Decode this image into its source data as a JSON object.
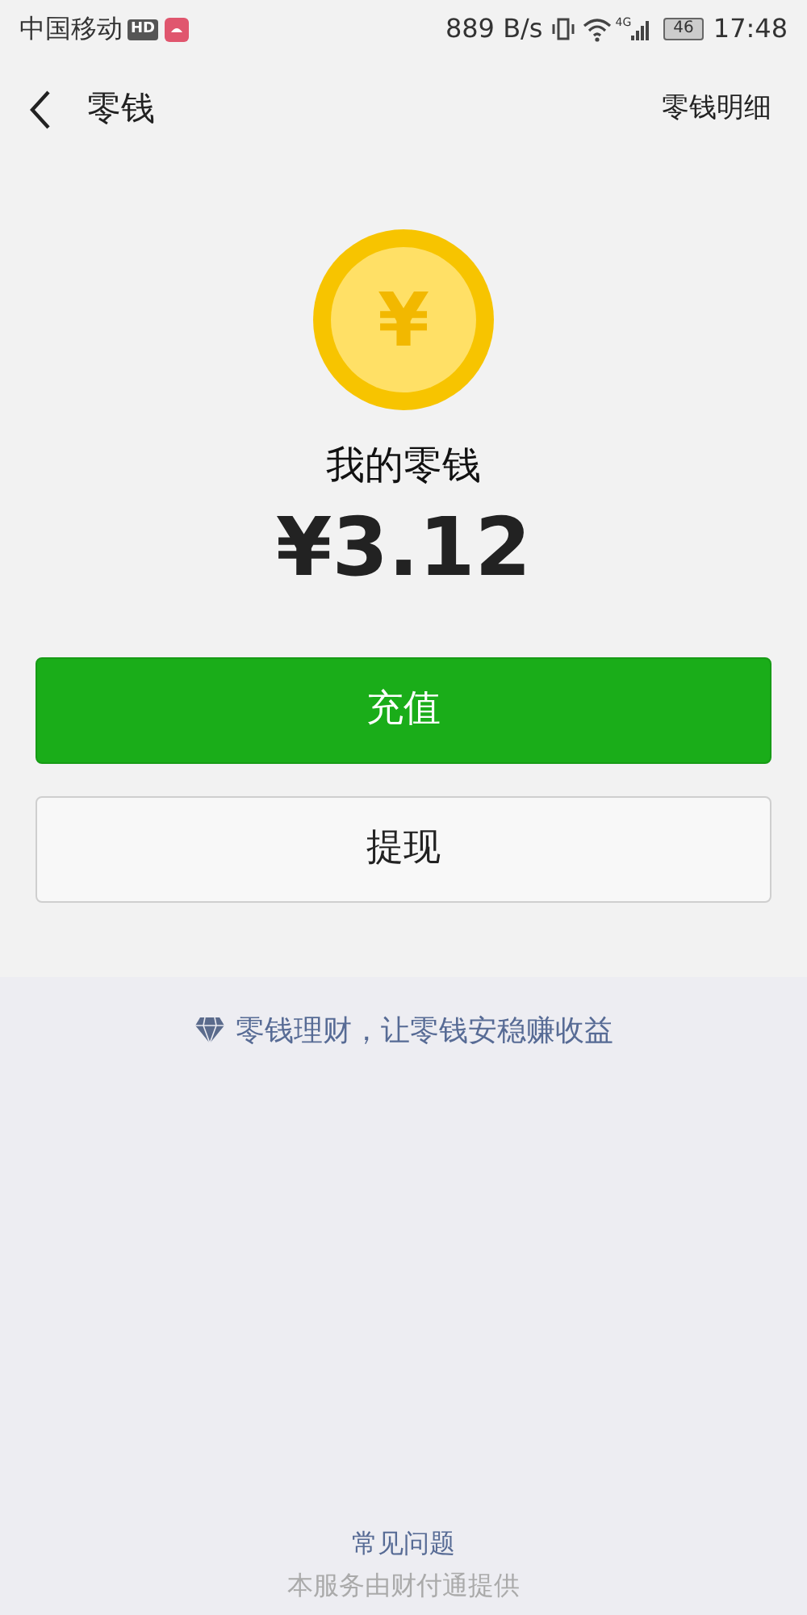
{
  "status_bar": {
    "carrier": "中国移动",
    "hd_badge": "HD",
    "speed": "889 B/s",
    "network": "4G",
    "battery": "46",
    "time": "17:48"
  },
  "nav": {
    "title": "零钱",
    "action": "零钱明细"
  },
  "balance": {
    "coin_symbol": "¥",
    "label": "我的零钱",
    "amount": "¥3.12"
  },
  "buttons": [
    {
      "label": "充值",
      "kind": "primary"
    },
    {
      "label": "提现",
      "kind": "secondary"
    }
  ],
  "promo": "零钱理财，让零钱安稳赚收益",
  "footer": {
    "link": "常见问题",
    "note": "本服务由财付通提供"
  }
}
